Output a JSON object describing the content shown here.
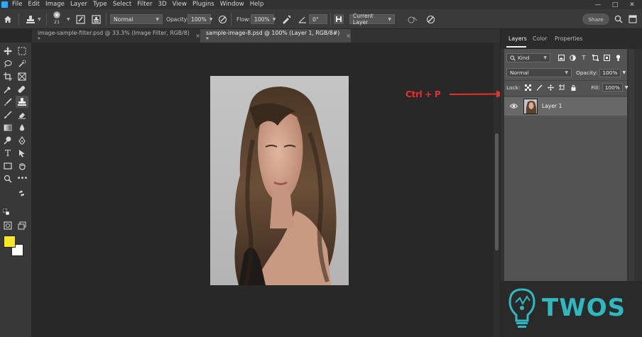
{
  "menu": [
    "File",
    "Edit",
    "Image",
    "Layer",
    "Type",
    "Select",
    "Filter",
    "3D",
    "View",
    "Plugins",
    "Window",
    "Help"
  ],
  "options_bar": {
    "brush_size": "21",
    "mode": "Normal",
    "opacity_label": "Opacity:",
    "opacity_value": "100%",
    "flow_label": "Flow:",
    "flow_value": "100%",
    "angle_value": "0°",
    "sample": "Current Layer",
    "share_label": "Share"
  },
  "tabs": [
    {
      "label": "image-sample-filter.psd @ 33.3% (Image Filter, RGB/8) *",
      "close": "×"
    },
    {
      "label": "sample-image-8.psd @ 100% (Layer 1, RGB/8#) *",
      "close": "×"
    }
  ],
  "panel": {
    "tabs": [
      "Layers",
      "Color",
      "Properties"
    ],
    "kind_label": "Kind",
    "blend_mode": "Normal",
    "opacity_label": "Opacity:",
    "opacity_value": "100%",
    "lock_label": "Lock:",
    "fill_label": "Fill:",
    "fill_value": "100%",
    "layer_name": "Layer 1"
  },
  "annotation": {
    "text": "Ctrl + P",
    "color": "#e8302a"
  },
  "watermark": {
    "text": "TWOS",
    "color": "#2fb8c0"
  },
  "colors": {
    "foreground": "#f6e829",
    "background": "#ffffff",
    "accent": "#31a8ff"
  }
}
